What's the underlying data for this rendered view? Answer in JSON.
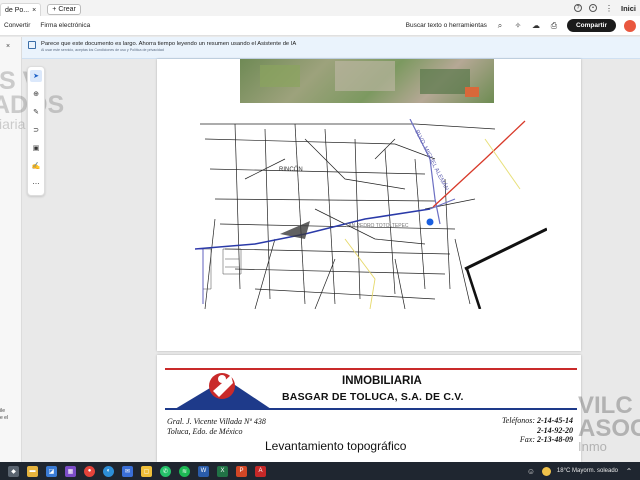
{
  "window": {
    "tab_title": "de Po...",
    "new_tab_label": "Crear",
    "right_label": "Inici"
  },
  "toolbar": {
    "menu_convert": "Convertir",
    "menu_sign": "Firma electrónica",
    "search_label": "Buscar texto o herramientas",
    "share_label": "Compartir"
  },
  "banner": {
    "text": "Parece que este documento es largo. Ahorra tiempo leyendo un resumen usando el Asistente de IA",
    "subtext": "Al usar este servicio, aceptas los Condiciones de uso y Política de privacidad"
  },
  "map": {
    "labels": {
      "rincon": "RINCÓN",
      "blvd": "BLVD. MIGUEL ALEMÁN",
      "san_pedro": "SAN PEDRO TOTOLTEPEC"
    }
  },
  "letterhead": {
    "company_line1": "INMOBILIARIA",
    "company_line2": "BASGAR DE TOLUCA, S.A. DE C.V.",
    "address_line1": "Gral. J. Vicente Villada Nº 438",
    "address_line2": "Toluca, Edo. de México",
    "phones_label": "Teléfonos:",
    "phone1": "2-14-45-14",
    "phone2": "2-14-92-20",
    "fax_label": "Fax:",
    "fax": "2-13-48-09",
    "doc_title": "Levantamiento topográfico"
  },
  "watermark": {
    "left_line1": "IS V",
    "left_line2": "ADOS",
    "left_line3": "ciaria",
    "right_line1": "VILC",
    "right_line2": "ASOC",
    "right_line3": "Inmo"
  },
  "side": {
    "line1": "ile",
    "line2": "e el"
  },
  "tray": {
    "weather": "18°C  Mayorm. soleado"
  },
  "colors": {
    "accent": "#1a5fc7",
    "share": "#1b1b1b",
    "letterhead_red": "#c92a2a",
    "letterhead_blue": "#1e3a8a"
  }
}
